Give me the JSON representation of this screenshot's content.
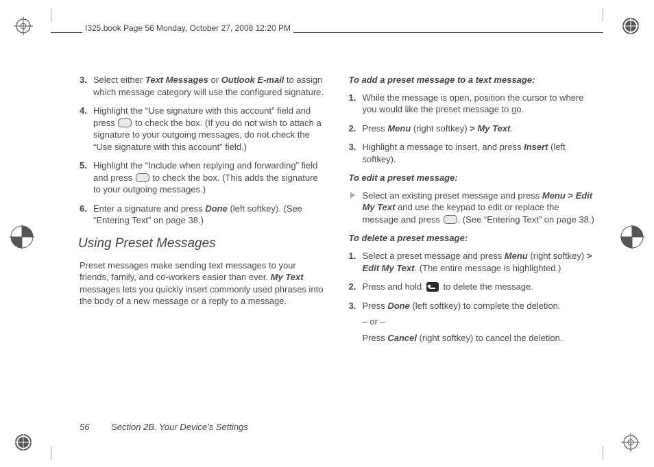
{
  "header": "I325.book  Page 56  Monday, October 27, 2008  12:20 PM",
  "left": {
    "s3_a": "Select either ",
    "s3_b": "Text Messages",
    "s3_c": " or ",
    "s3_d": "Outlook E-mail",
    "s3_e": " to assign which message category will use the configured signature.",
    "s4_a": "Highlight the “Use signature with this account” field and press ",
    "s4_b": " to check the box. (If you do not wish to attach a signature to your outgoing messages, do not check the “Use signature with this account” field.)",
    "s5_a": "Highlight the “Include when replying and forwarding” field and press ",
    "s5_b": " to check the box. (This adds the signature to your outgoing messages.)",
    "s6_a": "Enter a signature and press ",
    "s6_b": "Done",
    "s6_c": " (left softkey). (See “Entering Text” on page 38.)",
    "heading": "Using Preset Messages",
    "para_a": "Preset messages make sending text messages to your friends, family, and co-workers easier than ever. ",
    "para_b": "My Text",
    "para_c": " messages lets you quickly insert commonly used phrases into the body of a new message or a reply to a message."
  },
  "right": {
    "add_head": "To add a preset message to a text message:",
    "a1": "While the message is open, position the cursor to where you would like the preset message to go.",
    "a2_a": "Press ",
    "a2_b": "Menu",
    "a2_c": " (right softkey) ",
    "a2_d": ">",
    "a2_e": " My Text",
    "a2_f": ".",
    "a3_a": "Highlight a message to insert, and press ",
    "a3_b": "Insert",
    "a3_c": " (left softkey).",
    "edit_head": "To edit a preset message:",
    "e1_a": "Select an existing preset message and press ",
    "e1_b": "Menu",
    "e1_c": " ",
    "e1_d": ">",
    "e1_e": " Edit My Text",
    "e1_f": " and use the keypad to edit or replace the message and press ",
    "e1_g": ". (See “Entering Text” on page 38.)",
    "del_head": "To delete a preset message:",
    "d1_a": "Select a preset message and press ",
    "d1_b": "Menu",
    "d1_c": " (right softkey) ",
    "d1_d": ">",
    "d1_e": " Edit My Text",
    "d1_f": ". (The entire message is highlighted.)",
    "d2_a": "Press and hold ",
    "d2_b": " to delete the message.",
    "d3_a": "Press ",
    "d3_b": "Done",
    "d3_c": " (left softkey) to complete the deletion.",
    "or": "– or –",
    "d3_d": "Press ",
    "d3_e": "Cancel",
    "d3_f": " (right softkey) to cancel the deletion."
  },
  "footer": {
    "page": "56",
    "section": "Section 2B. Your Device’s Settings"
  }
}
